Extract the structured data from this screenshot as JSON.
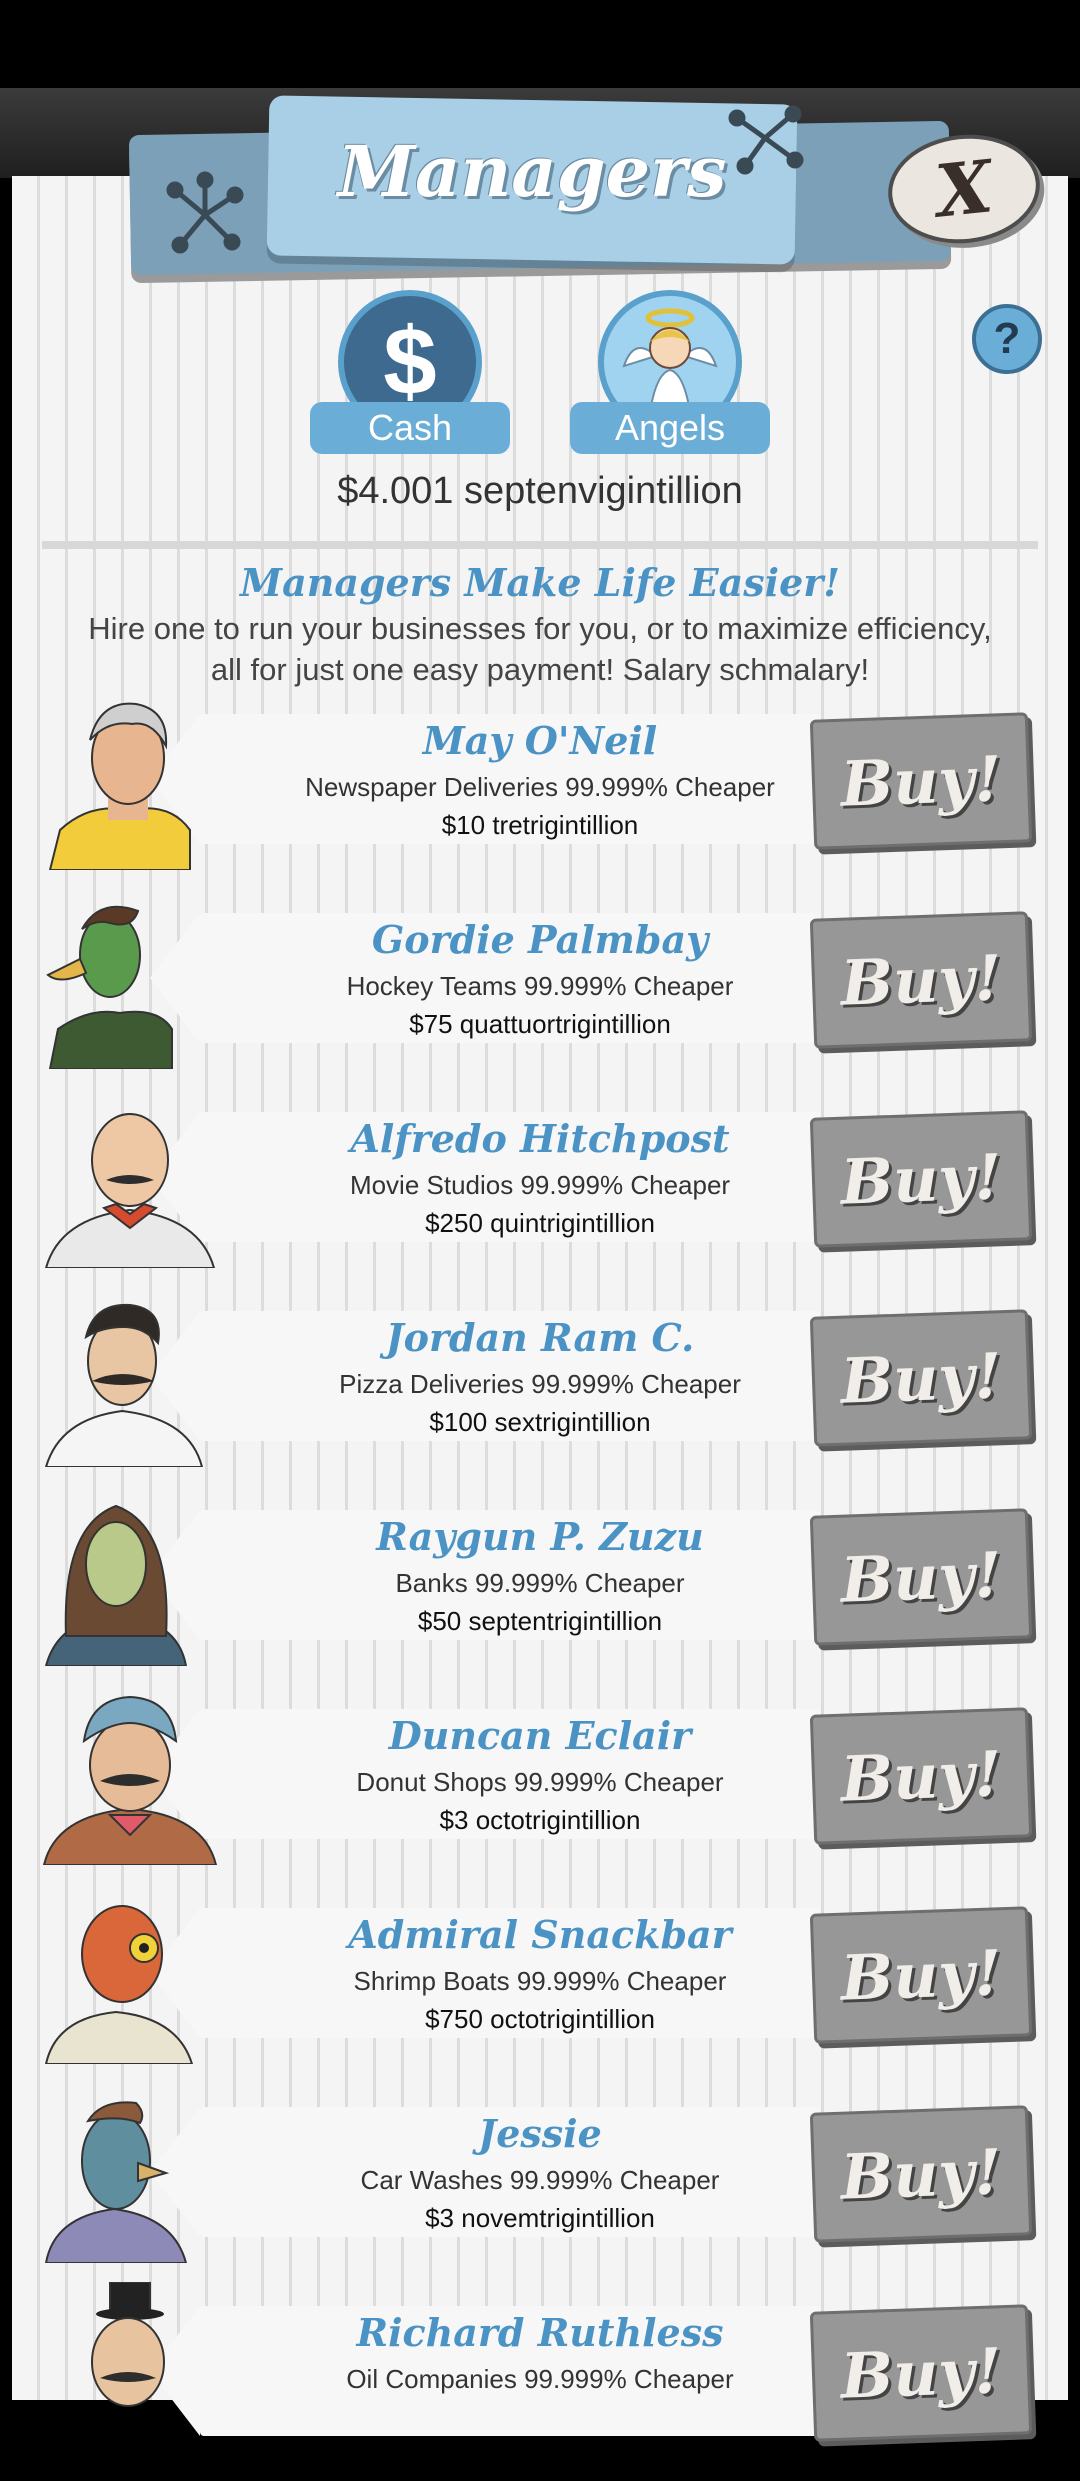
{
  "header": {
    "title": "Managers",
    "close_label": "X"
  },
  "tabs": [
    {
      "label": "Cash",
      "icon": "dollar-icon"
    },
    {
      "label": "Angels",
      "icon": "angel-icon"
    }
  ],
  "help_label": "?",
  "balance": "$4.001 septenvigintillion",
  "intro": {
    "title": "Managers Make Life Easier!",
    "text": "Hire one to run your businesses for you, or to maximize efficiency, all for just one easy payment! Salary schmalary!"
  },
  "managers": [
    {
      "name": "May O'Neil",
      "description": "Newspaper Deliveries 99.999% Cheaper",
      "cost": "$10 tretrigintillion",
      "buy_label": "Buy!"
    },
    {
      "name": "Gordie Palmbay",
      "description": "Hockey Teams 99.999% Cheaper",
      "cost": "$75 quattuortrigintillion",
      "buy_label": "Buy!"
    },
    {
      "name": "Alfredo Hitchpost",
      "description": "Movie Studios 99.999% Cheaper",
      "cost": "$250 quintrigintillion",
      "buy_label": "Buy!"
    },
    {
      "name": "Jordan Ram C.",
      "description": "Pizza Deliveries 99.999% Cheaper",
      "cost": "$100 sextrigintillion",
      "buy_label": "Buy!"
    },
    {
      "name": "Raygun P. Zuzu",
      "description": "Banks 99.999% Cheaper",
      "cost": "$50 septentrigintillion",
      "buy_label": "Buy!"
    },
    {
      "name": "Duncan Eclair",
      "description": "Donut Shops 99.999% Cheaper",
      "cost": "$3 octotrigintillion",
      "buy_label": "Buy!"
    },
    {
      "name": "Admiral Snackbar",
      "description": "Shrimp Boats 99.999% Cheaper",
      "cost": "$750 octotrigintillion",
      "buy_label": "Buy!"
    },
    {
      "name": "Jessie",
      "description": "Car Washes 99.999% Cheaper",
      "cost": "$3 novemtrigintillion",
      "buy_label": "Buy!"
    },
    {
      "name": "Richard Ruthless",
      "description": "Oil Companies 99.999% Cheaper",
      "cost": "",
      "buy_label": "Buy!"
    }
  ],
  "colors": {
    "accent_blue": "#4a93c4",
    "buy_gray": "#979797",
    "tab_blue": "#6aaed8"
  }
}
